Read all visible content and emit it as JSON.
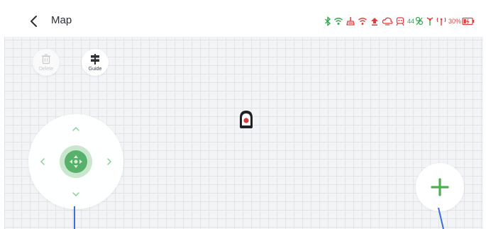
{
  "header": {
    "title": "Map",
    "back_icon": "chevron-left-icon",
    "status": {
      "icons": [
        "bluetooth-icon",
        "wifi-icon",
        "mop-icon",
        "wifi-alert-icon",
        "upload-alert-icon",
        "cloud-alert-icon",
        "robot-alert-icon",
        "signal-quality-icon",
        "antenna-icon",
        "cellular-icon",
        "battery-icon"
      ],
      "signal_text": "44",
      "battery_text": "30%",
      "battery_level": 0.3
    }
  },
  "toolbar": {
    "delete_label": "Delete",
    "guide_label": "Guide"
  },
  "joystick": {
    "arrows": [
      "up",
      "down",
      "left",
      "right"
    ]
  },
  "add_button": {
    "icon": "plus-icon"
  },
  "colors": {
    "accent_green": "#4caf50",
    "alert_red": "#e23b3b",
    "status_green": "#2fa84f",
    "path_blue": "#3a6fd8"
  }
}
